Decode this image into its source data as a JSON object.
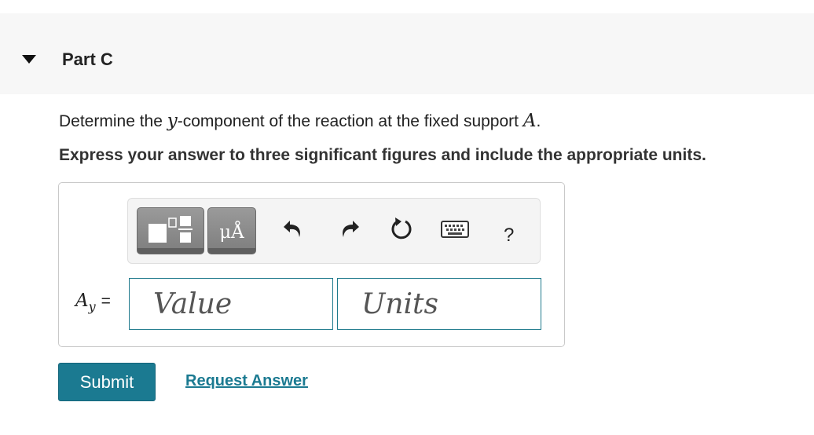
{
  "part": {
    "title": "Part C"
  },
  "question": {
    "prefix": "Determine the ",
    "var": "y",
    "middle": "-component of the reaction at the fixed support ",
    "support": "A",
    "suffix": "."
  },
  "instruction": "Express your answer to three significant figures and include the appropriate units.",
  "toolbar": {
    "units_glyph": "μÅ",
    "help_label": "?",
    "icons": [
      "templates-icon",
      "units-icon",
      "undo-icon",
      "redo-icon",
      "reset-icon",
      "keyboard-icon",
      "help-icon"
    ]
  },
  "answer": {
    "label_main": "A",
    "label_sub": "y",
    "label_eq": "=",
    "value_placeholder": "Value",
    "units_placeholder": "Units"
  },
  "actions": {
    "submit_label": "Submit",
    "request_label": "Request Answer"
  },
  "colors": {
    "accent": "#1b7a91",
    "header_bg": "#f7f7f7"
  }
}
